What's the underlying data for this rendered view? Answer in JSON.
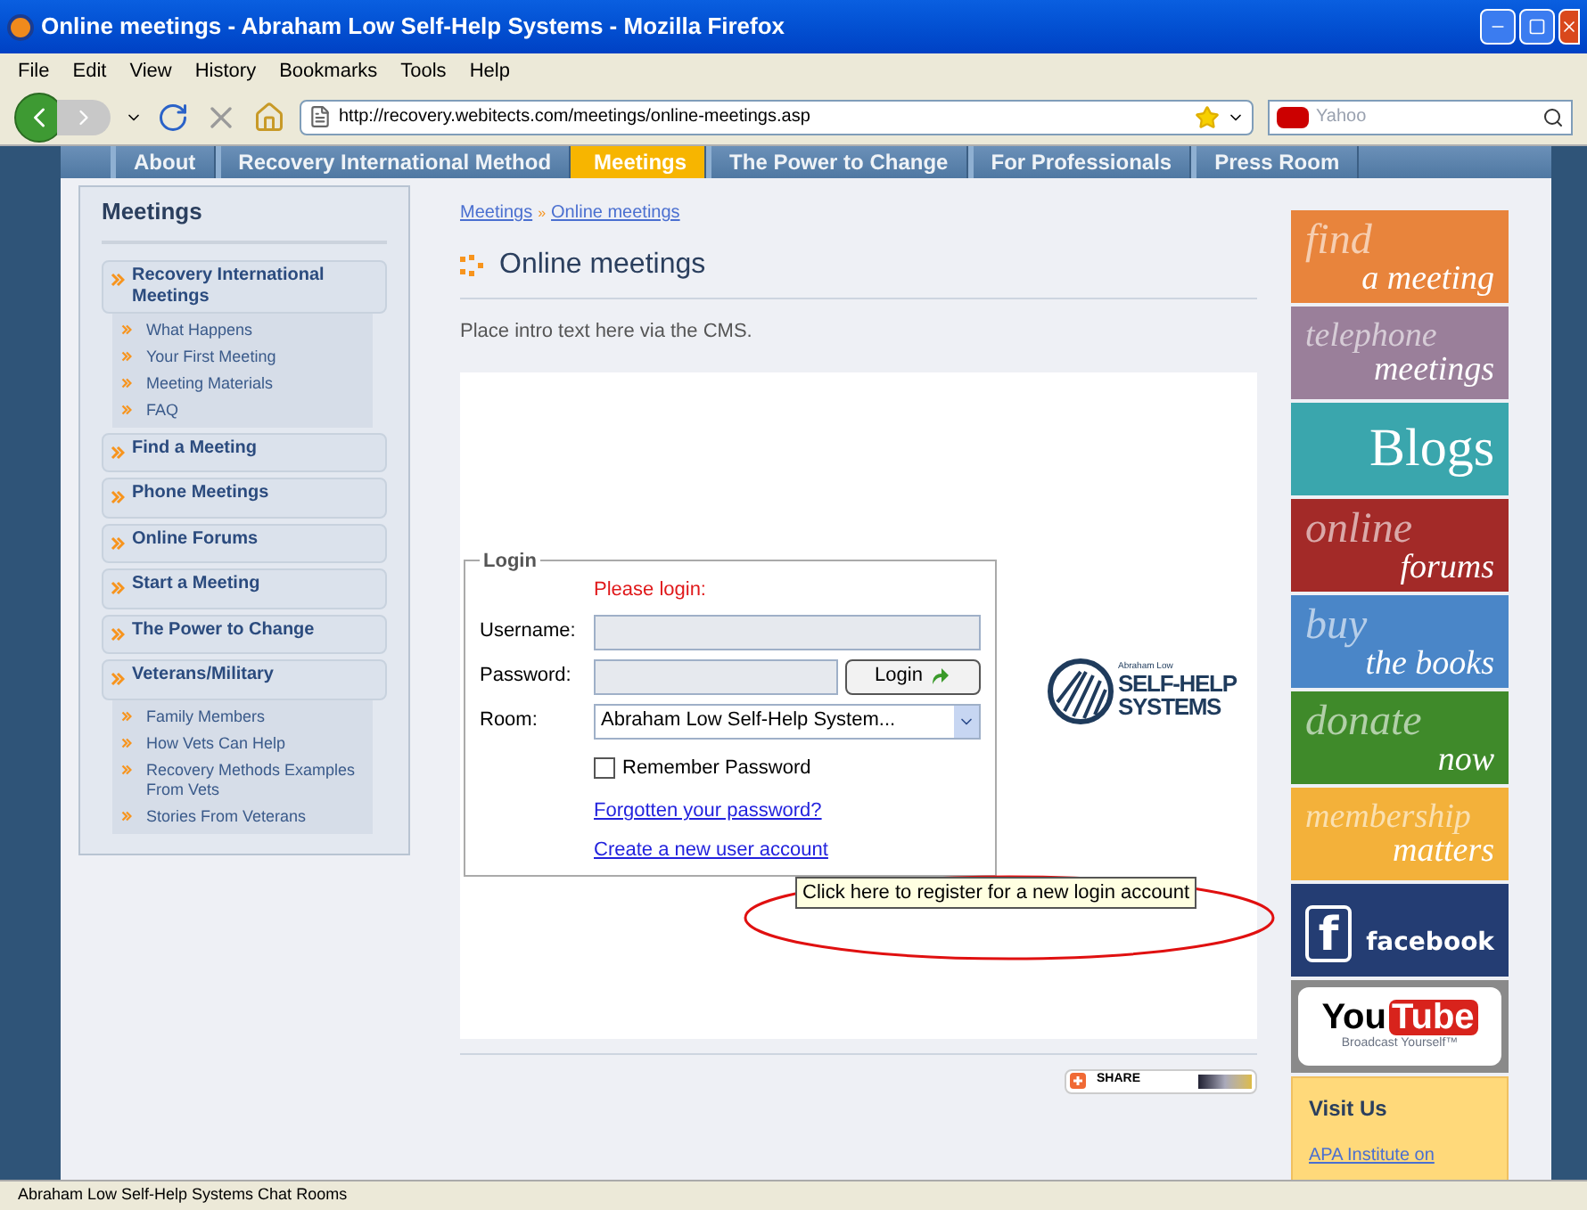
{
  "window": {
    "title": "Online meetings - Abraham Low Self-Help Systems - Mozilla Firefox"
  },
  "menu": [
    "File",
    "Edit",
    "View",
    "History",
    "Bookmarks",
    "Tools",
    "Help"
  ],
  "toolbar": {
    "url": "http://recovery.webitects.com/meetings/online-meetings.asp",
    "search_placeholder": "Yahoo"
  },
  "nav_tabs": [
    {
      "label": "About",
      "selected": false
    },
    {
      "label": "Recovery International Method",
      "selected": false
    },
    {
      "label": "Meetings",
      "selected": true
    },
    {
      "label": "The Power to Change",
      "selected": false
    },
    {
      "label": "For Professionals",
      "selected": false
    },
    {
      "label": "Press Room",
      "selected": false
    }
  ],
  "sidebar": {
    "title": "Meetings",
    "items": [
      {
        "label": "Recovery International Meetings",
        "children": [
          {
            "label": "What Happens"
          },
          {
            "label": "Your First Meeting"
          },
          {
            "label": "Meeting Materials"
          },
          {
            "label": "FAQ"
          }
        ]
      },
      {
        "label": "Find a Meeting"
      },
      {
        "label": "Phone Meetings"
      },
      {
        "label": "Online Forums"
      },
      {
        "label": "Start a Meeting"
      },
      {
        "label": "The Power to Change"
      },
      {
        "label": "Veterans/Military",
        "children": [
          {
            "label": "Family Members"
          },
          {
            "label": "How Vets Can Help"
          },
          {
            "label": "Recovery Methods Examples From Vets"
          },
          {
            "label": "Stories From Veterans"
          }
        ]
      }
    ]
  },
  "breadcrumb": [
    "Meetings",
    "»",
    "Online meetings"
  ],
  "page_title": "Online meetings",
  "intro": "Place intro text here via the CMS.",
  "login": {
    "legend": "Login",
    "prompt": "Please login:",
    "username_label": "Username:",
    "password_label": "Password:",
    "login_button": "Login",
    "room_label": "Room:",
    "room_value": "Abraham Low Self-Help System...",
    "remember_label": "Remember Password",
    "remember_checked": false,
    "forgot_link": "Forgotten your password?",
    "create_link": "Create a new user account"
  },
  "logo": {
    "small": "Abraham Low",
    "line_1": "SELF-HELP",
    "line_2": "SYSTEMS"
  },
  "tooltip": "Click here to register for a new login account",
  "share_button": "SHARE",
  "banners": [
    {
      "kind": "two-line",
      "lines": [
        "find",
        "a meeting"
      ],
      "color": "#e8843c"
    },
    {
      "kind": "two-line",
      "lines": [
        "telephone",
        "meetings"
      ],
      "color": "#9a7f9a"
    },
    {
      "kind": "one-line",
      "lines": [
        "Blogs"
      ],
      "color": "#3aa6ad"
    },
    {
      "kind": "two-line",
      "lines": [
        "online",
        "forums"
      ],
      "color": "#a32a28"
    },
    {
      "kind": "two-line",
      "lines": [
        "buy",
        "the books"
      ],
      "color": "#4a86c8"
    },
    {
      "kind": "two-line",
      "lines": [
        "donate",
        "now"
      ],
      "color": "#3f8a2a"
    },
    {
      "kind": "two-line",
      "lines": [
        "membership",
        "matters"
      ],
      "color": "#f3b13a"
    },
    {
      "kind": "facebook",
      "lines": [
        "f",
        "facebook"
      ],
      "color": "#243d73"
    },
    {
      "kind": "youtube",
      "lines": [
        "You",
        "Tube",
        "Broadcast Yourself™"
      ],
      "color": "#8a8a8a"
    }
  ],
  "visit": {
    "title": "Visit Us",
    "link": "APA Institute on"
  },
  "status_bar": "Abraham Low Self-Help Systems Chat Rooms"
}
